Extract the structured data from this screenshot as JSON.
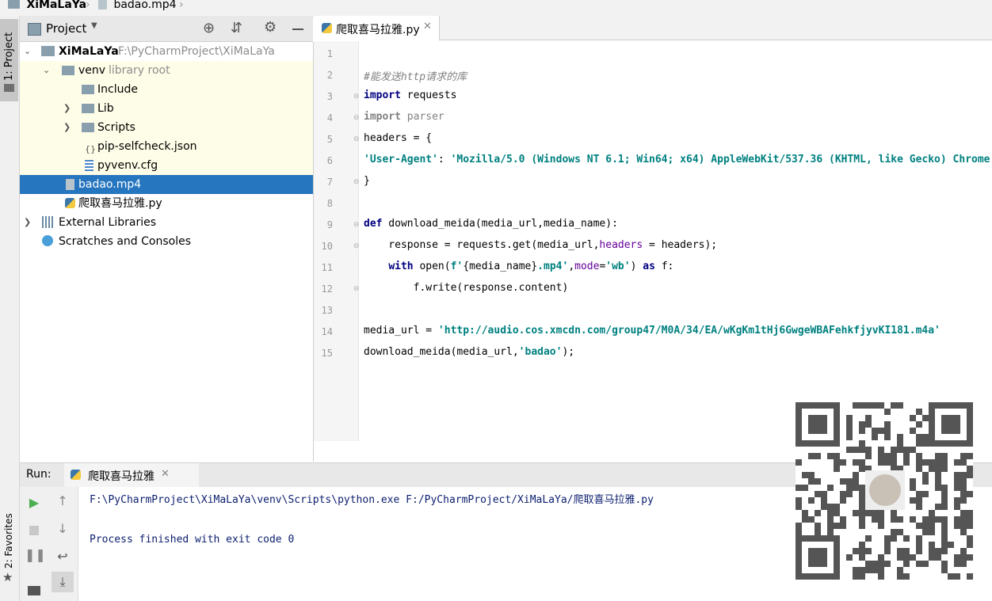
{
  "breadcrumb": {
    "project": "XiMaLaYa",
    "file": "badao.mp4"
  },
  "left_strip": {
    "project_tab": "1: Project",
    "favorites_tab": "2: Favorites"
  },
  "project_panel": {
    "title": "Project",
    "tree": [
      {
        "name": "XiMaLaYa",
        "path": "F:\\PyCharmProject\\XiMaLaYa"
      },
      {
        "name": "venv",
        "note": "library root"
      },
      {
        "name": "Include"
      },
      {
        "name": "Lib"
      },
      {
        "name": "Scripts"
      },
      {
        "name": "pip-selfcheck.json"
      },
      {
        "name": "pyvenv.cfg"
      },
      {
        "name": "badao.mp4"
      },
      {
        "name": "爬取喜马拉雅.py"
      },
      {
        "name": "External Libraries"
      },
      {
        "name": "Scratches and Consoles"
      }
    ]
  },
  "editor": {
    "tab_label": "爬取喜马拉雅.py",
    "line_numbers": [
      "1",
      "2",
      "3",
      "4",
      "5",
      "6",
      "7",
      "8",
      "9",
      "10",
      "11",
      "12",
      "13",
      "14",
      "15"
    ],
    "code": {
      "l2_comment": "#能发送http请求的库",
      "l3_kw": "import",
      "l3_rest": " requests",
      "l4_kw": "import",
      "l4_rest": " parser",
      "l5": "headers = {",
      "l6_key": "'User-Agent'",
      "l6_sep": ": ",
      "l6_val": "'Mozilla/5.0 (Windows NT 6.1; Win64; x64) AppleWebKit/537.36 (KHTML, like Gecko) Chrome",
      "l7": "}",
      "l9_kw": "def",
      "l9_rest": " download_meida(media_url,media_name):",
      "l10_a": "    response = requests.get(media_url,",
      "l10_kwa": "headers",
      "l10_b": " = headers);",
      "l11_a": "    ",
      "l11_kw": "with",
      "l11_b": " open(",
      "l11_f": "f'",
      "l11_c": "{media_name}",
      "l11_d": ".mp4'",
      "l11_e": ",",
      "l11_kwa": "mode",
      "l11_g": "=",
      "l11_h": "'wb'",
      "l11_i": ") ",
      "l11_kw2": "as",
      "l11_j": " f:",
      "l12": "        f.write(response.content)",
      "l14_a": "media_url = ",
      "l14_str": "'http://audio.cos.xmcdn.com/group47/M0A/34/EA/wKgKm1tHj6GwgeWBAFehkfjyvKI181.m4a'",
      "l15_a": "download_meida(media_url,",
      "l15_str": "'badao'",
      "l15_b": ");"
    }
  },
  "run_panel": {
    "label": "Run:",
    "tab_label": "爬取喜马拉雅",
    "output_command": "F:\\PyCharmProject\\XiMaLaYa\\venv\\Scripts\\python.exe F:/PyCharmProject/XiMaLaYa/爬取喜马拉雅.py",
    "output_status": "Process finished with exit code 0"
  },
  "colors": {
    "selection": "#2675bf",
    "venv_bg": "#fefde7",
    "keyword": "#000080",
    "string": "#008080"
  }
}
